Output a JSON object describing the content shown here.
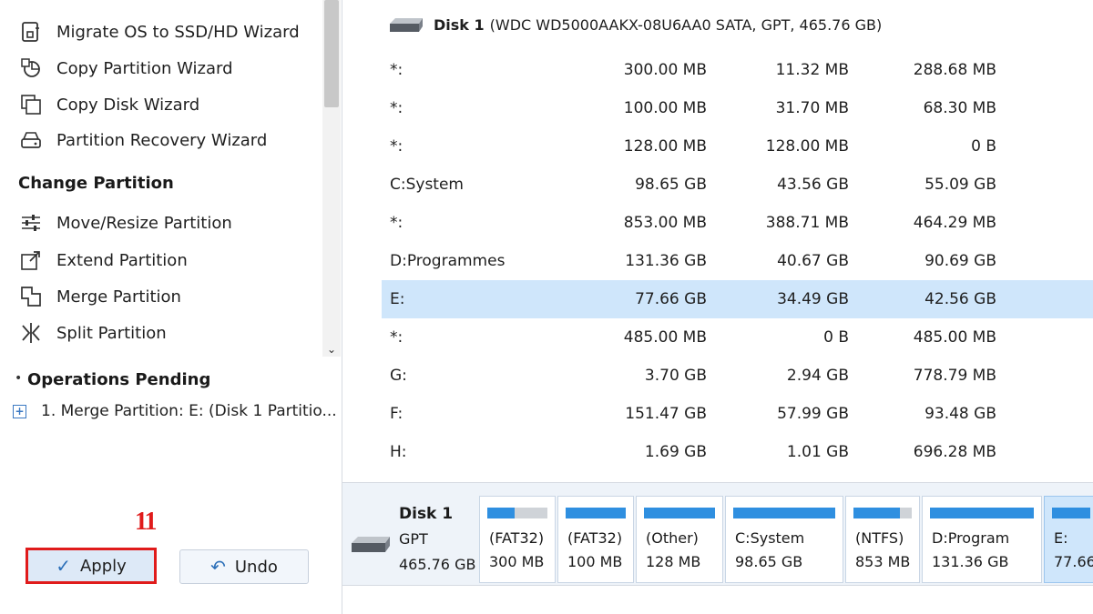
{
  "sidebar": {
    "wizard_items": [
      {
        "label": "Migrate OS to SSD/HD Wizard",
        "icon": "migrate-os-icon"
      },
      {
        "label": "Copy Partition Wizard",
        "icon": "copy-partition-icon"
      },
      {
        "label": "Copy Disk Wizard",
        "icon": "copy-disk-icon"
      },
      {
        "label": "Partition Recovery Wizard",
        "icon": "partition-recovery-icon"
      }
    ],
    "change_partition_heading": "Change Partition",
    "change_items": [
      {
        "label": "Move/Resize Partition",
        "icon": "sliders-icon"
      },
      {
        "label": "Extend Partition",
        "icon": "extend-icon"
      },
      {
        "label": "Merge Partition",
        "icon": "merge-icon"
      },
      {
        "label": "Split Partition",
        "icon": "split-icon"
      }
    ],
    "operations_heading": "Operations Pending",
    "pending_operation": "1. Merge Partition: E: (Disk 1 Partitio...",
    "step_marker": "11",
    "apply_label": "Apply",
    "undo_label": "Undo"
  },
  "main": {
    "disk_header": {
      "name": "Disk 1",
      "details": "(WDC WD5000AAKX-08U6AA0 SATA, GPT, 465.76 GB)"
    },
    "rows": [
      {
        "partition": "*:",
        "capacity": "300.00 MB",
        "used": "11.32 MB",
        "unused": "288.68 MB"
      },
      {
        "partition": "*:",
        "capacity": "100.00 MB",
        "used": "31.70 MB",
        "unused": "68.30 MB"
      },
      {
        "partition": "*:",
        "capacity": "128.00 MB",
        "used": "128.00 MB",
        "unused": "0 B"
      },
      {
        "partition": "C:System",
        "capacity": "98.65 GB",
        "used": "43.56 GB",
        "unused": "55.09 GB"
      },
      {
        "partition": "*:",
        "capacity": "853.00 MB",
        "used": "388.71 MB",
        "unused": "464.29 MB"
      },
      {
        "partition": "D:Programmes",
        "capacity": "131.36 GB",
        "used": "40.67 GB",
        "unused": "90.69 GB"
      },
      {
        "partition": "E:",
        "capacity": "77.66 GB",
        "used": "34.49 GB",
        "unused": "42.56 GB",
        "selected": true
      },
      {
        "partition": "*:",
        "capacity": "485.00 MB",
        "used": "0 B",
        "unused": "485.00 MB"
      },
      {
        "partition": "G:",
        "capacity": "3.70 GB",
        "used": "2.94 GB",
        "unused": "778.79 MB"
      },
      {
        "partition": "F:",
        "capacity": "151.47 GB",
        "used": "57.99 GB",
        "unused": "93.48 GB"
      },
      {
        "partition": "H:",
        "capacity": "1.69 GB",
        "used": "1.01 GB",
        "unused": "696.28 MB"
      }
    ],
    "disk_map": {
      "name": "Disk 1",
      "type": "GPT",
      "size": "465.76 GB",
      "blocks": [
        {
          "line1": "(FAT32)",
          "line2": "300 MB",
          "used_fraction": 0.45
        },
        {
          "line1": "(FAT32)",
          "line2": "100 MB",
          "used_fraction": 1.0
        },
        {
          "line1": "(Other)",
          "line2": "128 MB",
          "used_fraction": 1.0
        },
        {
          "line1": "C:System",
          "line2": "98.65 GB",
          "used_fraction": 1.0
        },
        {
          "line1": "(NTFS)",
          "line2": "853 MB",
          "used_fraction": 0.8
        },
        {
          "line1": "D:Program",
          "line2": "131.36 GB",
          "used_fraction": 1.0
        },
        {
          "line1": "E:",
          "line2": "77.66",
          "used_fraction": 1.0,
          "selected": true
        }
      ]
    }
  },
  "colors": {
    "selection": "#cfe6fb",
    "accent": "#2f8fe0",
    "highlight_red": "#e01b1b"
  }
}
